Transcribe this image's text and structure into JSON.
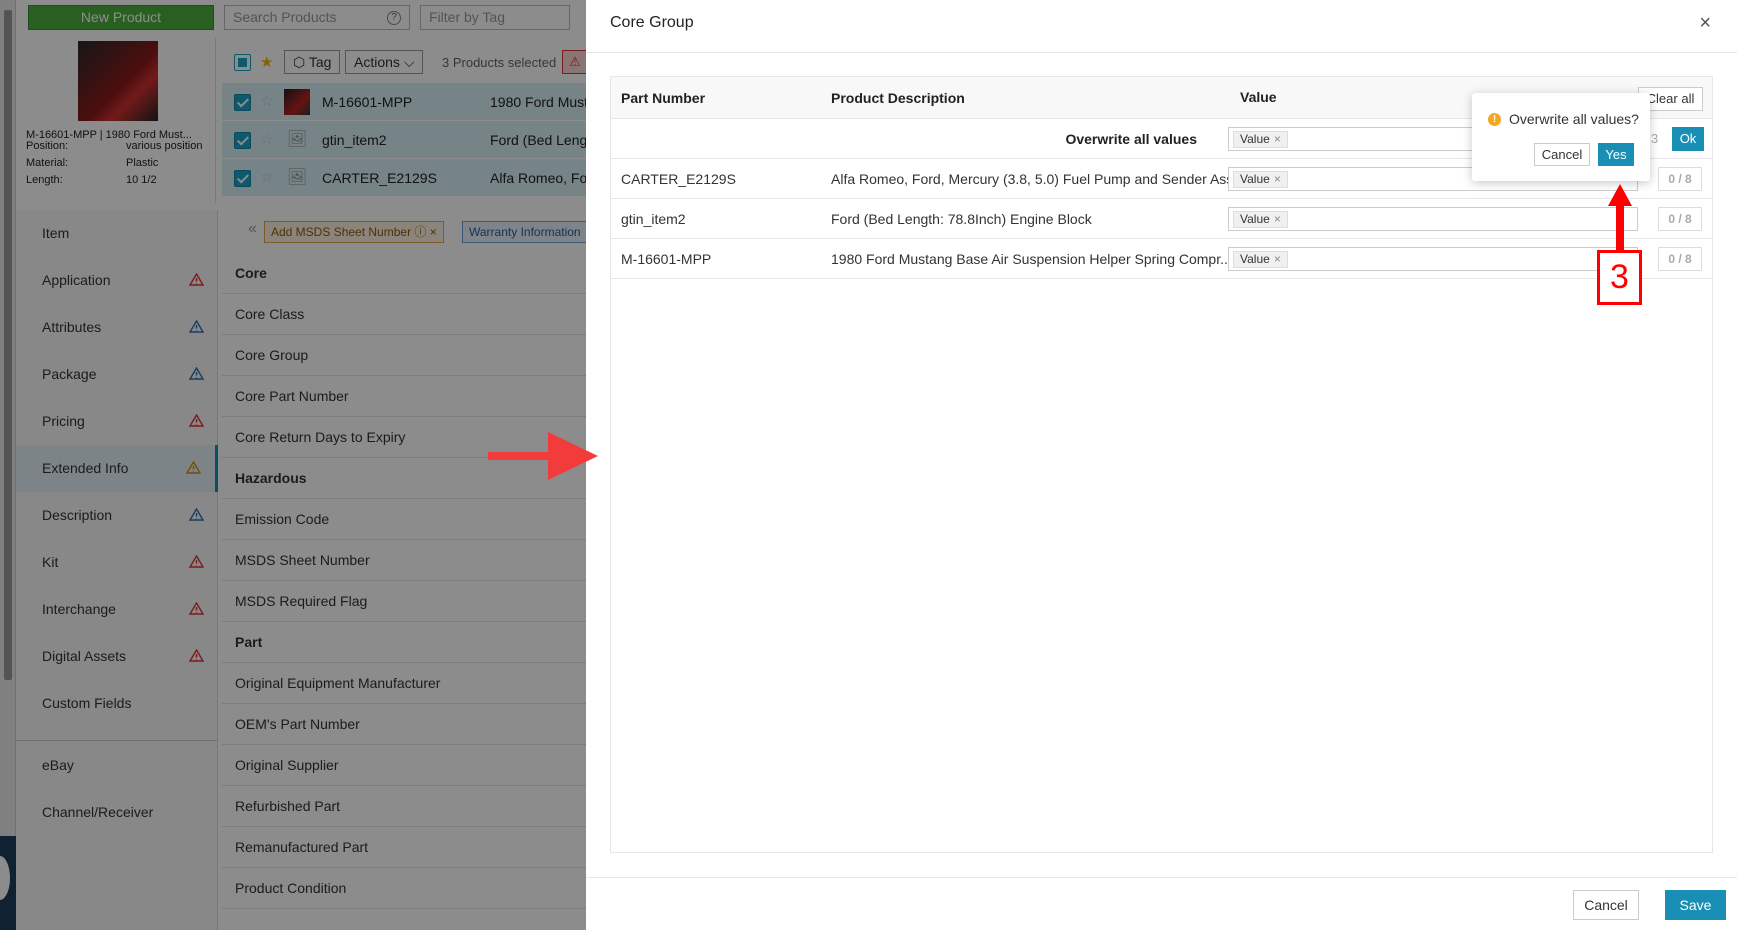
{
  "topbar": {
    "new_product": "New Product",
    "search_placeholder": "Search Products",
    "filter_placeholder": "Filter by Tag"
  },
  "product_card": {
    "name": "M-16601-MPP | 1980 Ford Must...",
    "specs": [
      {
        "label": "Position:",
        "value": "various position"
      },
      {
        "label": "Material:",
        "value": "Plastic"
      },
      {
        "label": "Length:",
        "value": "10 1/2"
      }
    ]
  },
  "toolbar": {
    "tag": "Tag",
    "actions": "Actions",
    "selected": "3 Products selected"
  },
  "product_rows": [
    {
      "part": "M-16601-MPP",
      "desc": "1980 Ford Must",
      "starred": false
    },
    {
      "part": "gtin_item2",
      "desc": "Ford (Bed Lengt",
      "starred": false
    },
    {
      "part": "CARTER_E2129S",
      "desc": "Alfa Romeo, For",
      "starred": false
    }
  ],
  "nav": {
    "items": [
      {
        "label": "Item",
        "warn": ""
      },
      {
        "label": "Application",
        "warn": "red"
      },
      {
        "label": "Attributes",
        "warn": "blue"
      },
      {
        "label": "Package",
        "warn": "blue"
      },
      {
        "label": "Pricing",
        "warn": "red"
      },
      {
        "label": "Extended Info",
        "warn": "orange"
      },
      {
        "label": "Description",
        "warn": "blue"
      },
      {
        "label": "Kit",
        "warn": "red"
      },
      {
        "label": "Interchange",
        "warn": "red"
      },
      {
        "label": "Digital Assets",
        "warn": "red"
      },
      {
        "label": "Custom Fields",
        "warn": ""
      },
      {
        "label": "eBay",
        "warn": ""
      },
      {
        "label": "Channel/Receiver",
        "warn": ""
      }
    ]
  },
  "tags": {
    "msds": "Add MSDS Sheet Number",
    "warranty": "Warranty Information"
  },
  "fields": [
    {
      "label": "Core",
      "group": true
    },
    {
      "label": "Core Class",
      "group": false
    },
    {
      "label": "Core Group",
      "group": false
    },
    {
      "label": "Core Part Number",
      "group": false
    },
    {
      "label": "Core Return Days to Expiry",
      "group": false
    },
    {
      "label": "Hazardous",
      "group": true
    },
    {
      "label": "Emission Code",
      "group": false
    },
    {
      "label": "MSDS Sheet Number",
      "group": false
    },
    {
      "label": "MSDS Required Flag",
      "group": false
    },
    {
      "label": "Part",
      "group": true
    },
    {
      "label": "Original Equipment Manufacturer",
      "group": false
    },
    {
      "label": "OEM's Part Number",
      "group": false
    },
    {
      "label": "Original Supplier",
      "group": false
    },
    {
      "label": "Refurbished Part",
      "group": false
    },
    {
      "label": "Remanufactured Part",
      "group": false
    },
    {
      "label": "Product Condition",
      "group": false
    }
  ],
  "drawer": {
    "title": "Core Group",
    "close": "×",
    "columns": {
      "part": "Part Number",
      "desc": "Product Description",
      "value": "Value"
    },
    "clear_all": "Clear all",
    "overwrite_label": "Overwrite all values",
    "overwrite_chip": "Value",
    "overwrite_count_partial": "3",
    "ok": "Ok",
    "rows": [
      {
        "part": "CARTER_E2129S",
        "desc": "Alfa Romeo, Ford, Mercury (3.8, 5.0) Fuel Pump and Sender Ass...",
        "chip": "Value",
        "count": "0 / 8"
      },
      {
        "part": "gtin_item2",
        "desc": "Ford (Bed Length: 78.8Inch) Engine Block",
        "chip": "Value",
        "count": "0 / 8"
      },
      {
        "part": "M-16601-MPP",
        "desc": "1980 Ford Mustang Base Air Suspension Helper Spring Compr...",
        "chip": "Value",
        "count": "0 / 8"
      }
    ],
    "footer": {
      "cancel": "Cancel",
      "save": "Save"
    }
  },
  "popconfirm": {
    "message": "Overwrite all values?",
    "cancel": "Cancel",
    "yes": "Yes"
  },
  "annotation": {
    "step": "3"
  },
  "colors": {
    "accent": "#1a8fb5",
    "green": "#4caf3f",
    "annotation_red": "#ff0000"
  }
}
